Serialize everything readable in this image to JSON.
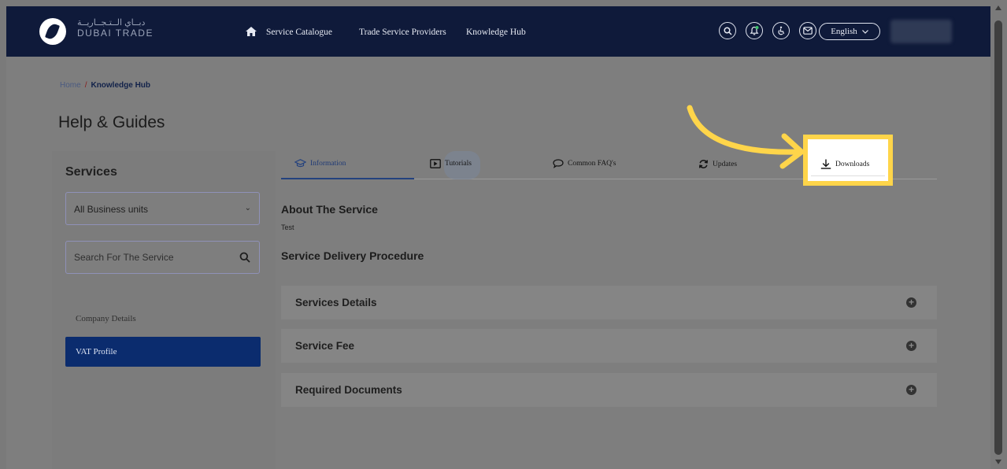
{
  "header": {
    "logo_arabic": "دبــاي الــتـجــاريــة",
    "logo_text": "DUBAI TRADE",
    "nav": [
      {
        "label": "Service Catalogue"
      },
      {
        "label": "Trade Service Providers"
      },
      {
        "label": "Knowledge Hub"
      }
    ],
    "icons": [
      "search-icon",
      "bell-icon",
      "accessibility-icon",
      "mail-icon"
    ],
    "language": "English"
  },
  "breadcrumb": {
    "home": "Home",
    "separator": "/",
    "current": "Knowledge Hub"
  },
  "page_title": "Help & Guides",
  "sidebar": {
    "heading": "Services",
    "business_unit_select": {
      "value": "All Business units"
    },
    "search": {
      "placeholder": "Search For The Service"
    },
    "items": [
      {
        "label": "Company Details",
        "active": false
      },
      {
        "label": "VAT Profile",
        "active": true
      }
    ]
  },
  "tabs": [
    {
      "label": "Information",
      "icon": "graduation-cap-icon",
      "active": true
    },
    {
      "label": "Tutorials",
      "icon": "video-play-icon",
      "active": false
    },
    {
      "label": "Common FAQ's",
      "icon": "chat-bubble-icon",
      "active": false
    },
    {
      "label": "Updates",
      "icon": "refresh-icon",
      "active": false
    },
    {
      "label": "Downloads",
      "icon": "download-icon",
      "active": false,
      "highlighted": true
    }
  ],
  "content": {
    "about_heading": "About The Service",
    "about_text": "Test",
    "procedure_heading": "Service Delivery Procedure",
    "accordions": [
      {
        "label": "Services Details"
      },
      {
        "label": "Service Fee"
      },
      {
        "label": "Required Documents"
      }
    ]
  },
  "colors": {
    "header_bg": "#0f1a3a",
    "active_item_bg": "#0b2c6e",
    "annotation_highlight": "#ffd54a"
  }
}
